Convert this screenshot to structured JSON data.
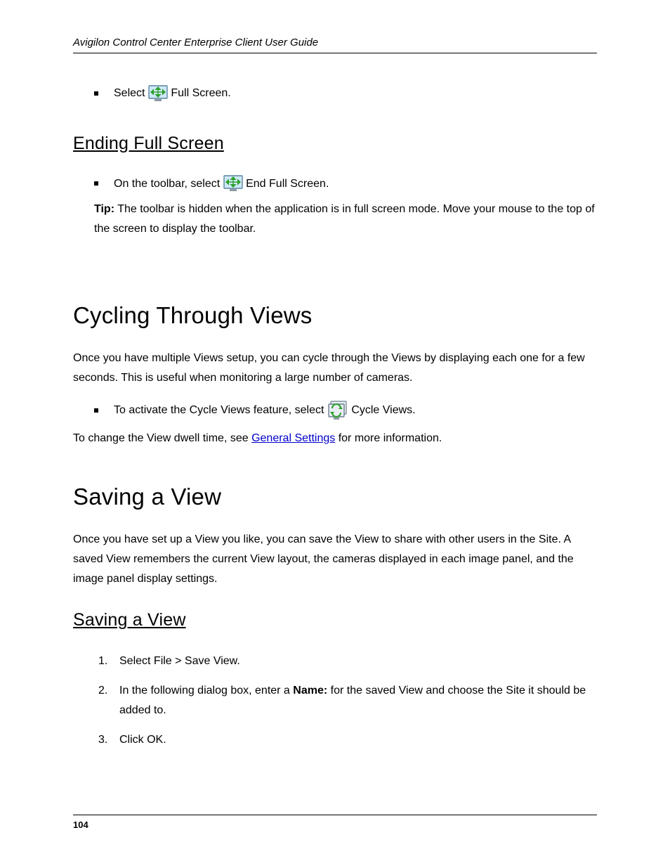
{
  "header": {
    "running": "Avigilon Control Center Enterprise Client User Guide"
  },
  "list1": {
    "before": "Select ",
    "after": " Full Screen."
  },
  "h2a": "Ending Full Screen",
  "list2": {
    "before": "On the toolbar, select ",
    "after": " End Full Screen."
  },
  "tip": {
    "label": "Tip:",
    "text": " The toolbar is hidden when the application is in full screen mode. Move your mouse to the top of the screen to display the toolbar."
  },
  "h1a": "Cycling Through Views",
  "cycle_para": "Once you have multiple Views setup, you can cycle through the Views by displaying each one for a few seconds. This is useful when monitoring a large number of cameras.",
  "cycle_bullet": {
    "before": "To activate the Cycle Views feature, select ",
    "after": " Cycle Views."
  },
  "cycle_link_intro": "To change the View dwell time, see ",
  "cycle_link": "General Settings",
  "cycle_link_after": " for more information.",
  "h1b": "Saving a View",
  "save_para": "Once you have set up a View you like, you can save the View to share with other users in the Site. A saved View remembers the current View layout, the cameras displayed in each image panel, and the image panel display settings.",
  "h2b": "Saving a View",
  "save_steps": {
    "s1": "Select File > Save View.",
    "s2a": "In the following dialog box, enter a ",
    "s2b": "Name:",
    "s2c": " for the saved View and choose the Site it should be added to.",
    "s3": "Click OK."
  },
  "footer": {
    "page": "104"
  }
}
